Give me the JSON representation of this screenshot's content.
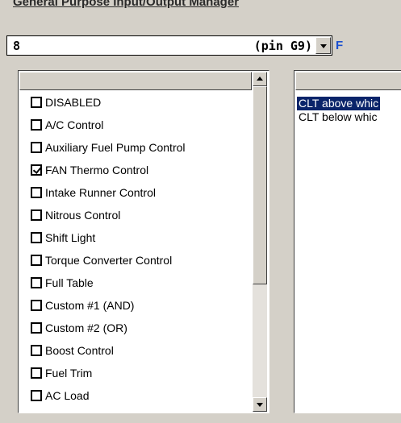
{
  "window": {
    "title": "General Purpose Input/Output Manager"
  },
  "pin_select": {
    "value": "8",
    "pin_label": "(pin G9)",
    "side_tag": "F"
  },
  "output_types": {
    "items": [
      {
        "label": "DISABLED",
        "checked": false
      },
      {
        "label": "A/C Control",
        "checked": false
      },
      {
        "label": "Auxiliary Fuel Pump Control",
        "checked": false
      },
      {
        "label": "FAN Thermo Control",
        "checked": true
      },
      {
        "label": "Intake Runner Control",
        "checked": false
      },
      {
        "label": "Nitrous Control",
        "checked": false
      },
      {
        "label": "Shift Light",
        "checked": false
      },
      {
        "label": "Torque Converter Control",
        "checked": false
      },
      {
        "label": "Full Table",
        "checked": false
      },
      {
        "label": "Custom #1 (AND)",
        "checked": false
      },
      {
        "label": "Custom #2 (OR)",
        "checked": false
      },
      {
        "label": "Boost Control",
        "checked": false
      },
      {
        "label": "Fuel Trim",
        "checked": false
      },
      {
        "label": "AC Load",
        "checked": false
      }
    ]
  },
  "parameters": {
    "items": [
      {
        "label": "CLT above whic",
        "selected": true
      },
      {
        "label": "CLT below whic",
        "selected": false
      }
    ]
  },
  "colors": {
    "background": "#d4d0c8",
    "selection": "#0a246a",
    "side_tag": "#1a4fd0"
  }
}
